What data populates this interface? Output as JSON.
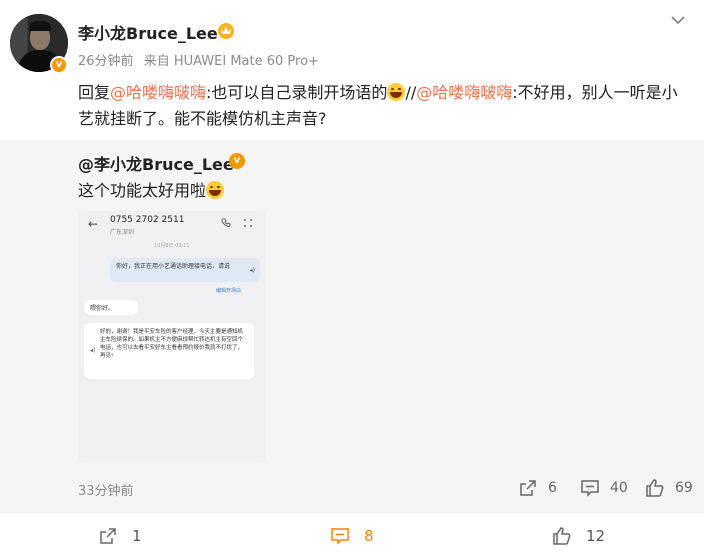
{
  "header": {
    "username": "李小龙Bruce_Lee",
    "time": "26分钟前",
    "source": "来自 HUAWEI Mate 60 Pro+"
  },
  "post": {
    "reply_prefix": "回复",
    "mention1": "@哈喽嗨啵嗨",
    "text1": ":也可以自己录制开场语的",
    "separator": "//",
    "mention2": "@哈喽嗨啵嗨",
    "text2": ":不好用，别人一听是小艺就挂断了。能不能模仿机主声音?"
  },
  "quoted": {
    "username": "@李小龙Bruce_Lee",
    "text": "这个功能太好用啦",
    "time": "33分钟前",
    "share_count": "6",
    "comment_count": "40",
    "like_count": "69",
    "screenshot": {
      "number": "0755 2702 2511",
      "location": "广东深圳",
      "date": "10月8日 09:11",
      "bubble_right": "你好，我正在用小艺通话助理接电话，请说",
      "edit_label": "编辑开场白",
      "bubble_left1": "喂你好。",
      "bubble_left2": "好的，谢谢！我是平安车险的客户经理，今天主要是通知机主车险续保的。如果机主不方便麻烦帮忙转达机主有空回个电话，也可以去看平安好车主看看预约报价我就不打扰了，再见!"
    }
  },
  "actions": {
    "repost_count": "1",
    "comment_count": "8",
    "like_count": "12"
  },
  "colors": {
    "mention": "#eb7350",
    "accent": "#ff8200",
    "vip_badge": "#f39800"
  }
}
